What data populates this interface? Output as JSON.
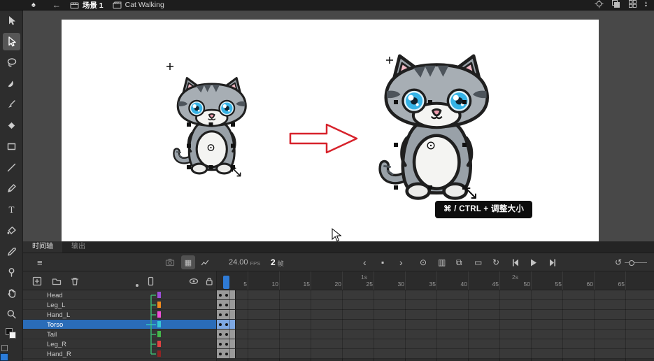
{
  "topbar": {
    "app_icon": "♠",
    "back_icon": "←",
    "scene_label": "场景 1",
    "symbol_label": "Cat Walking"
  },
  "canvas": {
    "tooltip": "⌘ / CTRL + 调整大小"
  },
  "timeline": {
    "tabs": [
      {
        "label": "时间轴",
        "active": true
      },
      {
        "label": "输出",
        "active": false
      }
    ],
    "toolbar": {
      "fps_value": "24.00",
      "fps_unit": "FPS",
      "frame_value": "2",
      "frame_unit": "帧",
      "icons": {
        "layers": "≡",
        "frames_view": "▦",
        "prev_kf": "‹",
        "insert_kf": "▪",
        "next_kf": "›",
        "onion": "⊙",
        "onion_outline": "▥",
        "edit_multi": "⧉",
        "range": "▭",
        "loop": "↻",
        "reset": "↺"
      }
    },
    "ruler": {
      "numbers": [
        5,
        10,
        15,
        20,
        25,
        30,
        35,
        40,
        45,
        50,
        55,
        60,
        65
      ],
      "seconds": [
        {
          "label": "1s",
          "frame": 24
        },
        {
          "label": "2s",
          "frame": 48
        }
      ],
      "playhead_frame": 2
    },
    "keyframes": [
      1,
      2
    ],
    "layers": [
      {
        "name": "Head",
        "color": "#9b4fd6",
        "selected": false
      },
      {
        "name": "Leg_L",
        "color": "#f08a1d",
        "selected": false
      },
      {
        "name": "Hand_L",
        "color": "#ef4fd8",
        "selected": false
      },
      {
        "name": "Torso",
        "color": "#35c8d6",
        "selected": true
      },
      {
        "name": "Tail",
        "color": "#43b84a",
        "selected": false
      },
      {
        "name": "Leg_R",
        "color": "#e04343",
        "selected": false
      },
      {
        "name": "Hand_R",
        "color": "#8f2323",
        "selected": false
      }
    ],
    "selection_color": "#2a6cb8"
  },
  "colors": {
    "accent_blue": "#2f7bd6",
    "arrow_red": "#d7222b"
  }
}
